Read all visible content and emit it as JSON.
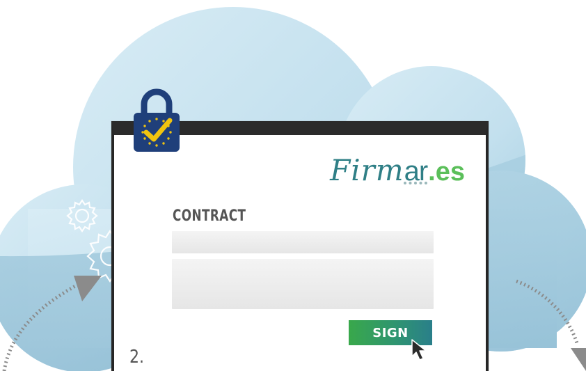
{
  "logo": {
    "script_text": "Firm",
    "mar_text": "ar",
    "es_text": ".es"
  },
  "contract": {
    "title": "CONTRACT",
    "fields": [
      "",
      ""
    ]
  },
  "sign_button": {
    "label": "SIGN"
  },
  "step": {
    "number": "2."
  },
  "icons": [
    "cloud-icon",
    "gears-icon",
    "padlock-eu-check-icon",
    "cursor-arrow-icon",
    "dotted-arrow-icon"
  ],
  "colors": {
    "cloud_light": "#cfe6f1",
    "cloud_dark": "#9ec8dc",
    "window_frame": "#2b2b2b",
    "accent_teal": "#2f7f86",
    "accent_green": "#5bbf5a",
    "lock_blue": "#1f3f7a",
    "check_yellow": "#f1c40f",
    "title_gray": "#555555"
  }
}
